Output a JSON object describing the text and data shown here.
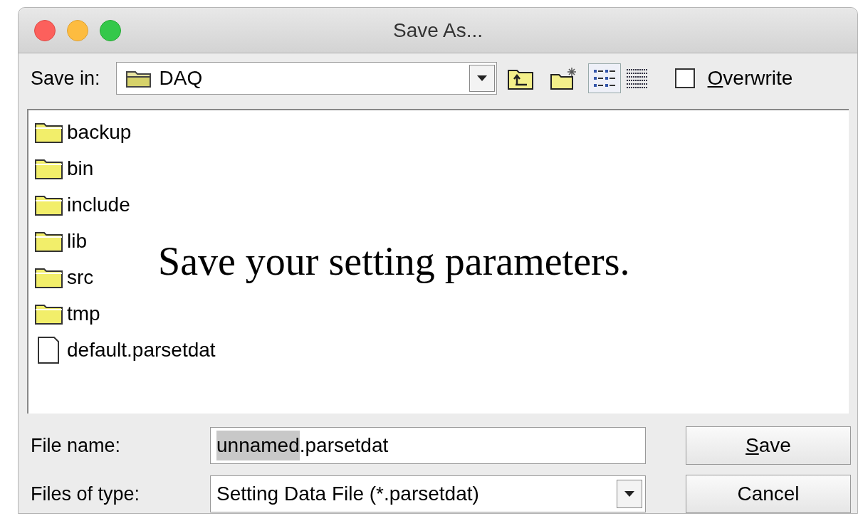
{
  "window": {
    "title": "Save As..."
  },
  "toolbar": {
    "save_in_label": "Save in:",
    "location": "DAQ",
    "overwrite": {
      "label": "Overwrite",
      "checked": false,
      "underline_first": true
    },
    "view_buttons": [
      {
        "kind": "list",
        "selected": true
      },
      {
        "kind": "details",
        "selected": false
      }
    ]
  },
  "files": [
    {
      "name": "backup",
      "kind": "folder"
    },
    {
      "name": "bin",
      "kind": "folder"
    },
    {
      "name": "include",
      "kind": "folder"
    },
    {
      "name": "lib",
      "kind": "folder"
    },
    {
      "name": "src",
      "kind": "folder"
    },
    {
      "name": "tmp",
      "kind": "folder"
    },
    {
      "name": "default.parsetdat",
      "kind": "file"
    }
  ],
  "caption": "Save your setting parameters.",
  "file_name": {
    "label": "File name:",
    "selected_part": "unnamed",
    "rest": ".parsetdat"
  },
  "file_type": {
    "label": "Files of type:",
    "value": "Setting Data File (*.parsetdat)"
  },
  "buttons": [
    {
      "label": "Save",
      "underline_first": true
    },
    {
      "label": "Cancel",
      "underline_first": false
    }
  ]
}
